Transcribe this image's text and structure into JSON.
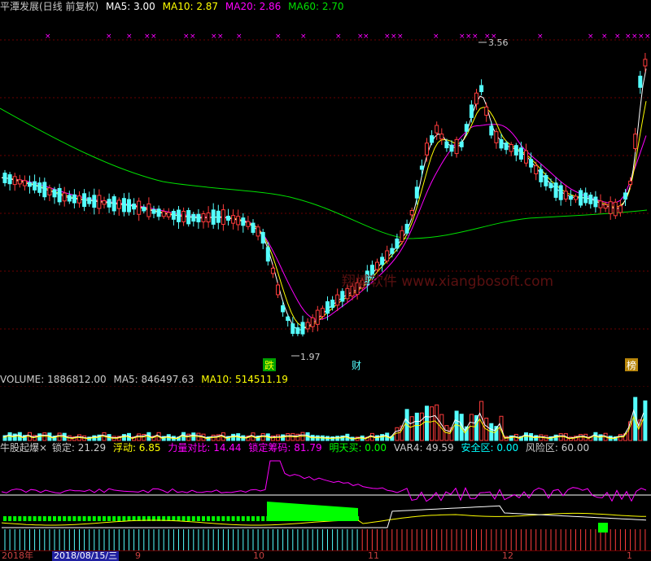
{
  "main_header": {
    "title": "平潭发展(日线 前复权)",
    "ma5_label": "MA5: 3.00",
    "ma10_label": "MA10: 2.87",
    "ma20_label": "MA20: 2.86",
    "ma60_label": "MA60: 2.70"
  },
  "price_annotations": {
    "high_label": "3.56",
    "low_label": "1.97",
    "marker_1": "跌",
    "marker_2": "财",
    "marker_3": "榜"
  },
  "watermark": "翔博软件 www.xiangbosoft.com",
  "volume_header": {
    "title": "VOLUME: 1886812.00",
    "ma5": "MA5: 846497.63",
    "ma10": "MA10: 514511.19"
  },
  "indicator_header": {
    "name": "牛股起爆×",
    "lock": "锁定: 21.29",
    "float": "浮动: 6.85",
    "power": "力量对比: 14.44",
    "chip": "锁定筹码: 81.79",
    "buy": "明天买: 0.00",
    "var4": "VAR4: 49.59",
    "safe": "安全区: 0.00",
    "risk": "风险区: 60.00"
  },
  "time_axis": {
    "year": "2018年",
    "cursor_date": "2018/08/15/三",
    "month_9": "9",
    "month_10": "10",
    "month_11": "11",
    "month_12": "12",
    "month_1": "1"
  },
  "colors": {
    "up": "#ff3c3c",
    "down": "#54ffff",
    "ma5": "#ffffff",
    "ma10": "#ffff00",
    "ma20": "#ff00ff",
    "ma60": "#00e000",
    "grid": "#8b0000",
    "x_marker": "#ff00ff"
  },
  "chart_data": {
    "type": "candlestick",
    "y_high": 3.56,
    "y_low": 1.97,
    "ma": {
      "ma5": 3.0,
      "ma10": 2.87,
      "ma20": 2.86,
      "ma60": 2.7
    },
    "volume": {
      "latest": 1886812.0,
      "ma5": 846497.63,
      "ma10": 514511.19
    }
  }
}
